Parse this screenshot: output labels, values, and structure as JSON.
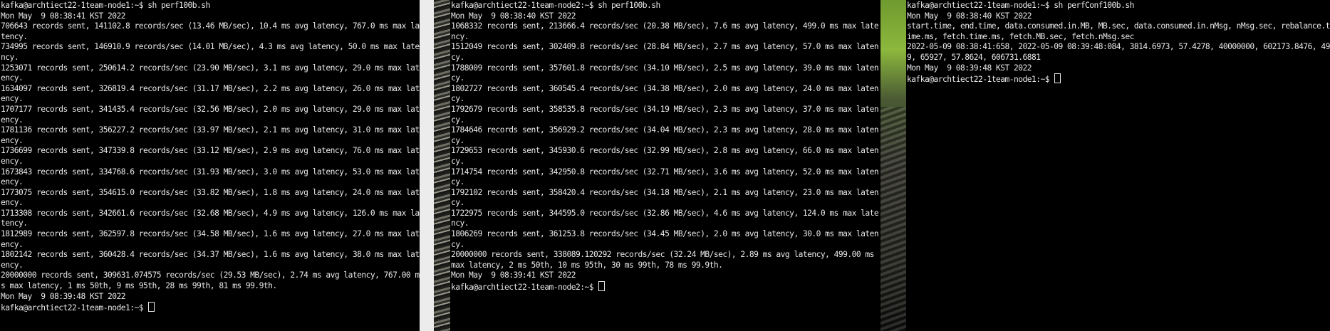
{
  "terminals": [
    {
      "prompt": "kafka@archtiect22-1team-node1:~$ sh perf100b.sh",
      "lines": [
        "Mon May  9 08:38:41 KST 2022",
        "706643 records sent, 141102.8 records/sec (13.46 MB/sec), 10.4 ms avg latency, 767.0 ms max la",
        "tency.",
        "734995 records sent, 146910.9 records/sec (14.01 MB/sec), 4.3 ms avg latency, 50.0 ms max late",
        "ncy.",
        "1253071 records sent, 250614.2 records/sec (23.90 MB/sec), 3.1 ms avg latency, 29.0 ms max lat",
        "ency.",
        "1634097 records sent, 326819.4 records/sec (31.17 MB/sec), 2.2 ms avg latency, 26.0 ms max lat",
        "ency.",
        "1707177 records sent, 341435.4 records/sec (32.56 MB/sec), 2.0 ms avg latency, 29.0 ms max lat",
        "ency.",
        "1781136 records sent, 356227.2 records/sec (33.97 MB/sec), 2.1 ms avg latency, 31.0 ms max lat",
        "ency.",
        "1736699 records sent, 347339.8 records/sec (33.12 MB/sec), 2.9 ms avg latency, 76.0 ms max lat",
        "ency.",
        "1673843 records sent, 334768.6 records/sec (31.93 MB/sec), 3.0 ms avg latency, 53.0 ms max lat",
        "ency.",
        "1773075 records sent, 354615.0 records/sec (33.82 MB/sec), 1.8 ms avg latency, 24.0 ms max lat",
        "ency.",
        "1713308 records sent, 342661.6 records/sec (32.68 MB/sec), 4.9 ms avg latency, 126.0 ms max la",
        "tency.",
        "1812989 records sent, 362597.8 records/sec (34.58 MB/sec), 1.6 ms avg latency, 27.0 ms max lat",
        "ency.",
        "1802142 records sent, 360428.4 records/sec (34.37 MB/sec), 1.6 ms avg latency, 38.0 ms max lat",
        "ency.",
        "20000000 records sent, 309631.074575 records/sec (29.53 MB/sec), 2.74 ms avg latency, 767.00 m",
        "s max latency, 1 ms 50th, 9 ms 95th, 28 ms 99th, 81 ms 99.9th.",
        "Mon May  9 08:39:48 KST 2022"
      ],
      "final_prompt": "kafka@archtiect22-1team-node1:~$ "
    },
    {
      "prompt": "kafka@archtiect22-1team-node2:~$ sh perf100b.sh",
      "lines": [
        "Mon May  9 08:38:40 KST 2022",
        "1068332 records sent, 213666.4 records/sec (20.38 MB/sec), 7.6 ms avg latency, 499.0 ms max late",
        "ncy.",
        "1512049 records sent, 302409.8 records/sec (28.84 MB/sec), 2.7 ms avg latency, 57.0 ms max laten",
        "cy.",
        "1788009 records sent, 357601.8 records/sec (34.10 MB/sec), 2.5 ms avg latency, 39.0 ms max laten",
        "cy.",
        "1802727 records sent, 360545.4 records/sec (34.38 MB/sec), 2.0 ms avg latency, 24.0 ms max laten",
        "cy.",
        "1792679 records sent, 358535.8 records/sec (34.19 MB/sec), 2.3 ms avg latency, 37.0 ms max laten",
        "cy.",
        "1784646 records sent, 356929.2 records/sec (34.04 MB/sec), 2.3 ms avg latency, 28.0 ms max laten",
        "cy.",
        "1729653 records sent, 345930.6 records/sec (32.99 MB/sec), 2.8 ms avg latency, 66.0 ms max laten",
        "cy.",
        "1714754 records sent, 342950.8 records/sec (32.71 MB/sec), 3.6 ms avg latency, 52.0 ms max laten",
        "cy.",
        "1792102 records sent, 358420.4 records/sec (34.18 MB/sec), 2.1 ms avg latency, 23.0 ms max laten",
        "cy.",
        "1722975 records sent, 344595.0 records/sec (32.86 MB/sec), 4.6 ms avg latency, 124.0 ms max late",
        "ncy.",
        "1806269 records sent, 361253.8 records/sec (34.45 MB/sec), 2.0 ms avg latency, 30.0 ms max laten",
        "cy.",
        "20000000 records sent, 338089.120292 records/sec (32.24 MB/sec), 2.89 ms avg latency, 499.00 ms",
        "max latency, 2 ms 50th, 10 ms 95th, 30 ms 99th, 78 ms 99.9th.",
        "Mon May  9 08:39:41 KST 2022"
      ],
      "final_prompt": "kafka@archtiect22-1team-node2:~$ "
    },
    {
      "prompt": "kafka@archtiect22-1team-node1:~$ sh perfConf100b.sh",
      "lines": [
        "Mon May  9 08:38:40 KST 2022",
        "start.time, end.time, data.consumed.in.MB, MB.sec, data.consumed.in.nMsg, nMsg.sec, rebalance.t",
        "ime.ms, fetch.time.ms, fetch.MB.sec, fetch.nMsg.sec",
        "2022-05-09 08:38:41:658, 2022-05-09 08:39:48:084, 3814.6973, 57.4278, 40000000, 602173.8476, 49",
        "9, 65927, 57.8624, 606731.6881",
        "Mon May  9 08:39:48 KST 2022"
      ],
      "final_prompt": "kafka@archtiect22-1team-node1:~$ "
    }
  ]
}
